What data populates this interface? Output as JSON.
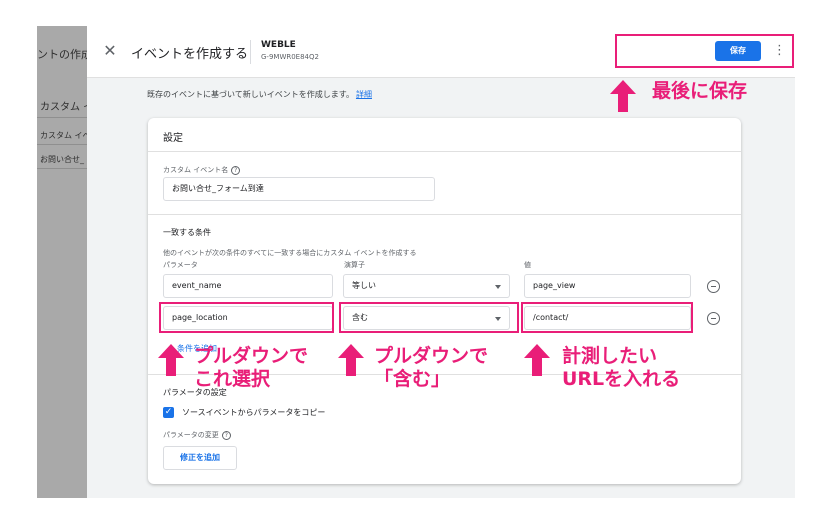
{
  "background": {
    "title_fragment": "ントの作成",
    "item1": "カスタム イ",
    "item2": "カスタム イベ",
    "item3": "お問い合せ_"
  },
  "header": {
    "close_icon": "close-icon",
    "title": "イベントを作成する",
    "property_name": "WEBLE",
    "property_id": "G-9MWR0E84Q2",
    "save_label": "保存",
    "more_icon": "more-vert-icon"
  },
  "description": {
    "text": "既存のイベントに基づいて新しいイベントを作成します。",
    "link": "詳細"
  },
  "card": {
    "title": "設定",
    "custom_event_label": "カスタム イベント名",
    "custom_event_value": "お問い合せ_フォーム到達",
    "conditions_title": "一致する条件",
    "conditions_desc": "他のイベントが次の条件のすべてに一致する場合にカスタム イベントを作成する",
    "col_param": "パラメータ",
    "col_operator": "演算子",
    "col_value": "値",
    "rows": [
      {
        "param": "event_name",
        "operator": "等しい",
        "value": "page_view"
      },
      {
        "param": "page_location",
        "operator": "含む",
        "value": "/contact/"
      }
    ],
    "add_condition": "条件を追加",
    "param_settings": "パラメータの設定",
    "copy_params": "ソースイベントからパラメータをコピー",
    "modify_params": "パラメータの変更",
    "add_modification": "修正を追加"
  },
  "annotations": {
    "save_note": "最後に保存",
    "param_note_1": "プルダウンで",
    "param_note_2": "これ選択",
    "operator_note_1": "プルダウンで",
    "operator_note_2": "「含む」",
    "value_note_1": "計測したい",
    "value_note_2": "URLを入れる",
    "color": "#e91e78"
  }
}
